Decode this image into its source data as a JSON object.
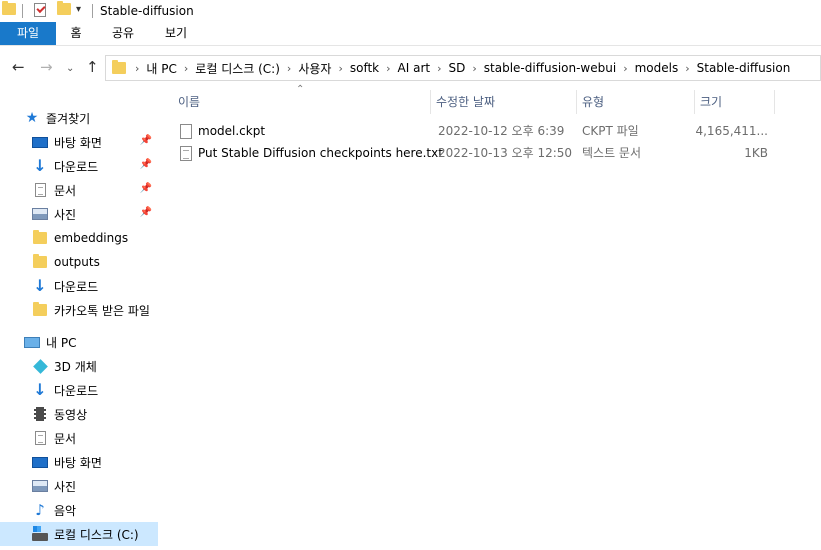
{
  "window": {
    "title": "Stable-diffusion"
  },
  "ribbon": {
    "tabs": [
      "파일",
      "홈",
      "공유",
      "보기"
    ]
  },
  "address": {
    "crumbs": [
      "내 PC",
      "로컬 디스크 (C:)",
      "사용자",
      "softk",
      "AI art",
      "SD",
      "stable-diffusion-webui",
      "models",
      "Stable-diffusion"
    ]
  },
  "sidebar": {
    "quick_access": "즐겨찾기",
    "items": [
      "바탕 화면",
      "다운로드",
      "문서",
      "사진",
      "embeddings",
      "outputs",
      "다운로드",
      "카카오톡 받은 파일"
    ],
    "this_pc": "내 PC",
    "pc_items": [
      "3D 개체",
      "다운로드",
      "동영상",
      "문서",
      "바탕 화면",
      "사진",
      "음악",
      "로컬 디스크 (C:)"
    ]
  },
  "columns": {
    "name": "이름",
    "date": "수정한 날짜",
    "type": "유형",
    "size": "크기"
  },
  "files": [
    {
      "name": "model.ckpt",
      "date": "2022-10-12 오후 6:39",
      "type": "CKPT 파일",
      "size": "4,165,411..."
    },
    {
      "name": "Put Stable Diffusion checkpoints here.txt",
      "date": "2022-10-13 오후 12:50",
      "type": "텍스트 문서",
      "size": "1KB"
    }
  ],
  "colors": {
    "accent": "#1979ca",
    "selected": "#cce8ff",
    "header_text": "#4d6082"
  }
}
